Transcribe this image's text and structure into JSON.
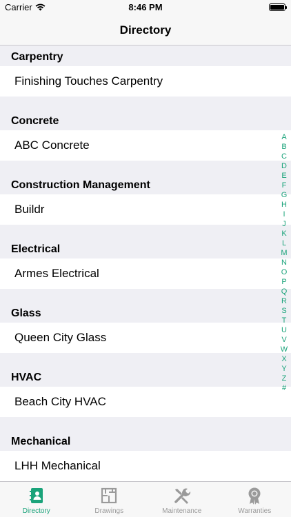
{
  "status": {
    "carrier": "Carrier",
    "time": "8:46 PM"
  },
  "nav": {
    "title": "Directory"
  },
  "sections": [
    {
      "header": "Carpentry",
      "items": [
        "Finishing Touches Carpentry"
      ]
    },
    {
      "header": "Concrete",
      "items": [
        "ABC Concrete"
      ]
    },
    {
      "header": "Construction Management",
      "items": [
        "Buildr"
      ]
    },
    {
      "header": "Electrical",
      "items": [
        "Armes Electrical"
      ]
    },
    {
      "header": "Glass",
      "items": [
        "Queen City Glass"
      ]
    },
    {
      "header": "HVAC",
      "items": [
        "Beach City HVAC"
      ]
    },
    {
      "header": "Mechanical",
      "items": [
        "LHH Mechanical"
      ]
    }
  ],
  "index": [
    "A",
    "B",
    "C",
    "D",
    "E",
    "F",
    "G",
    "H",
    "I",
    "J",
    "K",
    "L",
    "M",
    "N",
    "O",
    "P",
    "Q",
    "R",
    "S",
    "T",
    "U",
    "V",
    "W",
    "X",
    "Y",
    "Z",
    "#"
  ],
  "tabs": [
    {
      "label": "Directory",
      "icon": "directory-icon",
      "active": true
    },
    {
      "label": "Drawings",
      "icon": "drawings-icon",
      "active": false
    },
    {
      "label": "Maintenance",
      "icon": "maintenance-icon",
      "active": false
    },
    {
      "label": "Warranties",
      "icon": "warranties-icon",
      "active": false
    }
  ],
  "colors": {
    "accent": "#1aa37a",
    "inactive": "#9a9a9a"
  }
}
